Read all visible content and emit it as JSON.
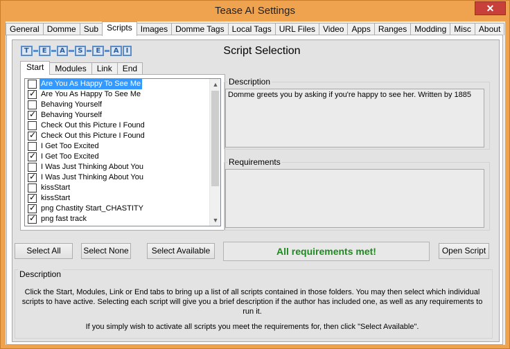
{
  "window": {
    "title": "Tease AI Settings",
    "close_glyph": "✕"
  },
  "tabs": [
    "General",
    "Domme",
    "Sub",
    "Scripts",
    "Images",
    "Domme Tags",
    "Local Tags",
    "URL Files",
    "Video",
    "Apps",
    "Ranges",
    "Modding",
    "Misc",
    "About"
  ],
  "active_tab": "Scripts",
  "logo": {
    "text": "TEASE AI",
    "letters": [
      "T",
      "E",
      "A",
      "S",
      "E",
      "A",
      "I"
    ]
  },
  "section_title": "Script Selection",
  "subtabs": [
    "Start",
    "Modules",
    "Link",
    "End"
  ],
  "active_subtab": "Start",
  "scripts": [
    {
      "label": "Are You As Happy To See Me",
      "checked": false,
      "selected": true
    },
    {
      "label": "Are You As Happy To See Me",
      "checked": true,
      "selected": false
    },
    {
      "label": "Behaving Yourself",
      "checked": false,
      "selected": false
    },
    {
      "label": "Behaving Yourself",
      "checked": true,
      "selected": false
    },
    {
      "label": "Check Out this Picture I Found",
      "checked": false,
      "selected": false
    },
    {
      "label": "Check Out this Picture I Found",
      "checked": true,
      "selected": false
    },
    {
      "label": "I Get Too Excited",
      "checked": false,
      "selected": false
    },
    {
      "label": "I Get Too Excited",
      "checked": true,
      "selected": false
    },
    {
      "label": "I Was Just Thinking About You",
      "checked": false,
      "selected": false
    },
    {
      "label": "I Was Just Thinking About You",
      "checked": true,
      "selected": false
    },
    {
      "label": "kissStart",
      "checked": false,
      "selected": false
    },
    {
      "label": "kissStart",
      "checked": true,
      "selected": false
    },
    {
      "label": "png Chastity Start_CHASTITY",
      "checked": true,
      "selected": false
    },
    {
      "label": "png fast track",
      "checked": true,
      "selected": false
    }
  ],
  "scroll": {
    "up": "▲",
    "down": "▼"
  },
  "description": {
    "label": "Description",
    "text": "Domme greets you by asking if you're happy to see her. Written by 1885"
  },
  "requirements": {
    "label": "Requirements",
    "text": ""
  },
  "buttons": {
    "select_all": "Select All",
    "select_none": "Select None",
    "select_available": "Select Available",
    "open_script": "Open Script"
  },
  "status": {
    "text": "All requirements met!",
    "color": "#1f8a1f"
  },
  "help": {
    "label": "Description",
    "line1": "Click the Start, Modules, Link or End tabs to bring up a list of all scripts contained in those folders. You may then select which individual scripts to have active. Selecting each script will give you a brief description if the author has included one, as well as any requirements to run it.",
    "line2": "If you simply wish to activate all scripts you meet the requirements for, then click \"Select Available\"."
  }
}
